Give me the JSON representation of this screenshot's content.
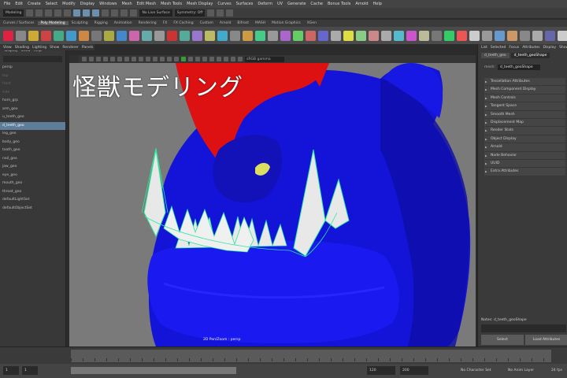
{
  "menubar": {
    "items": [
      "File",
      "Edit",
      "Create",
      "Select",
      "Modify",
      "Display",
      "Windows",
      "Mesh",
      "Edit Mesh",
      "Mesh Tools",
      "Mesh Display",
      "Curves",
      "Surfaces",
      "Deform",
      "UV",
      "Generate",
      "Cache",
      "Bonus Tools",
      "Arnold",
      "Help"
    ],
    "workspace": "Modeling"
  },
  "statusline": {
    "live_surface": "No Live Surface",
    "symmetry": "Symmetry: Off"
  },
  "shelf": {
    "tabs": [
      "Curves / Surfaces",
      "Poly Modeling",
      "Sculpting",
      "Rigging",
      "Animation",
      "Rendering",
      "FX",
      "FX Caching",
      "Custom",
      "Arnold",
      "Bifrost",
      "MASH",
      "Motion Graphics",
      "XGen"
    ],
    "active_tab": "Poly Modeling"
  },
  "outliner": {
    "menu": [
      "Display",
      "Show",
      "Help"
    ],
    "panel_menu": [
      "View",
      "Shading",
      "Lighting",
      "Show",
      "Renderer",
      "Panels"
    ],
    "rows": [
      {
        "label": "persp",
        "state": "normal"
      },
      {
        "label": "top",
        "state": "dim"
      },
      {
        "label": "front",
        "state": "dim"
      },
      {
        "label": "side",
        "state": "dim"
      },
      {
        "label": "horn_grp",
        "state": "normal"
      },
      {
        "label": "arm_geo",
        "state": "normal"
      },
      {
        "label": "u_teeth_geo",
        "state": "normal"
      },
      {
        "label": "d_teeth_geo",
        "state": "sel"
      },
      {
        "label": "leg_geo",
        "state": "normal"
      },
      {
        "label": "body_geo",
        "state": "normal"
      },
      {
        "label": "tooth_geo",
        "state": "normal"
      },
      {
        "label": "nail_geo",
        "state": "normal"
      },
      {
        "label": "jaw_geo",
        "state": "normal"
      },
      {
        "label": "eye_geo",
        "state": "normal"
      },
      {
        "label": "mouth_geo",
        "state": "normal"
      },
      {
        "label": "throat_geo",
        "state": "normal"
      },
      {
        "label": "defaultLightSet",
        "state": "normal"
      },
      {
        "label": "defaultObjectSet",
        "state": "normal"
      }
    ]
  },
  "viewport": {
    "overlay_title": "怪獣モデリング",
    "camera_field": "sRGB gamma",
    "hud": "2D Pan/Zoom : persp"
  },
  "attribute_editor": {
    "tabs": [
      "List",
      "Selected",
      "Focus",
      "Attributes",
      "Display",
      "Show",
      "Help"
    ],
    "node_tabs": [
      "d_teeth_geo",
      "d_teeth_geoShape"
    ],
    "active_node_tab": "d_teeth_geoShape",
    "mesh_label": "mesh:",
    "mesh_value": "d_teeth_geoShape",
    "sections": [
      "Tessellation Attributes",
      "Mesh Component Display",
      "Mesh Controls",
      "Tangent Space",
      "Smooth Mesh",
      "Displacement Map",
      "Render Stats",
      "Object Display",
      "Arnold",
      "Node Behavior",
      "UUID",
      "Extra Attributes"
    ],
    "notes_label": "Notes:  d_teeth_geoShape",
    "select_button": "Select",
    "load_button": "Load Attributes"
  },
  "timeline": {
    "start": "1",
    "current": "1",
    "end": "120",
    "end2": "200",
    "character_set": "No Character Set",
    "anim_layer": "No Anim Layer",
    "fps": "24 fps"
  },
  "colors": {
    "monster_blue": "#1010d8",
    "horn_red": "#dd1111",
    "teeth": "#e8e8e8",
    "selection_wire": "#2ee8a0",
    "eye": "#dddd60",
    "selected_row": "#5d7d9a"
  }
}
